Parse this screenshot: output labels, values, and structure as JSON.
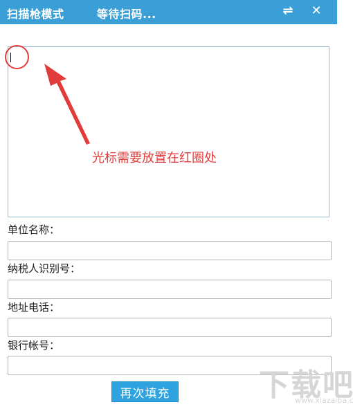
{
  "title_bar": {
    "mode": "扫描枪模式",
    "status": "等待扫码...",
    "swap_icon": "swap-arrows-icon",
    "close_icon": "close-icon",
    "swap_glyph": "⇌",
    "close_glyph": "✕"
  },
  "scan_area": {
    "value": "",
    "annotation": "光标需要放置在红圈处"
  },
  "fields": [
    {
      "label": "单位名称：",
      "value": ""
    },
    {
      "label": "纳税人识别号：",
      "value": ""
    },
    {
      "label": "地址电话：",
      "value": ""
    },
    {
      "label": "银行帐号：",
      "value": ""
    }
  ],
  "buttons": {
    "refill": "再次填充"
  },
  "watermark": {
    "logo": "下载吧",
    "url": "www.xiazaiba.com"
  },
  "colors": {
    "title_bar": "#3a9fd6",
    "annotation": "#e23b3b",
    "button": "#2ea3e0"
  }
}
